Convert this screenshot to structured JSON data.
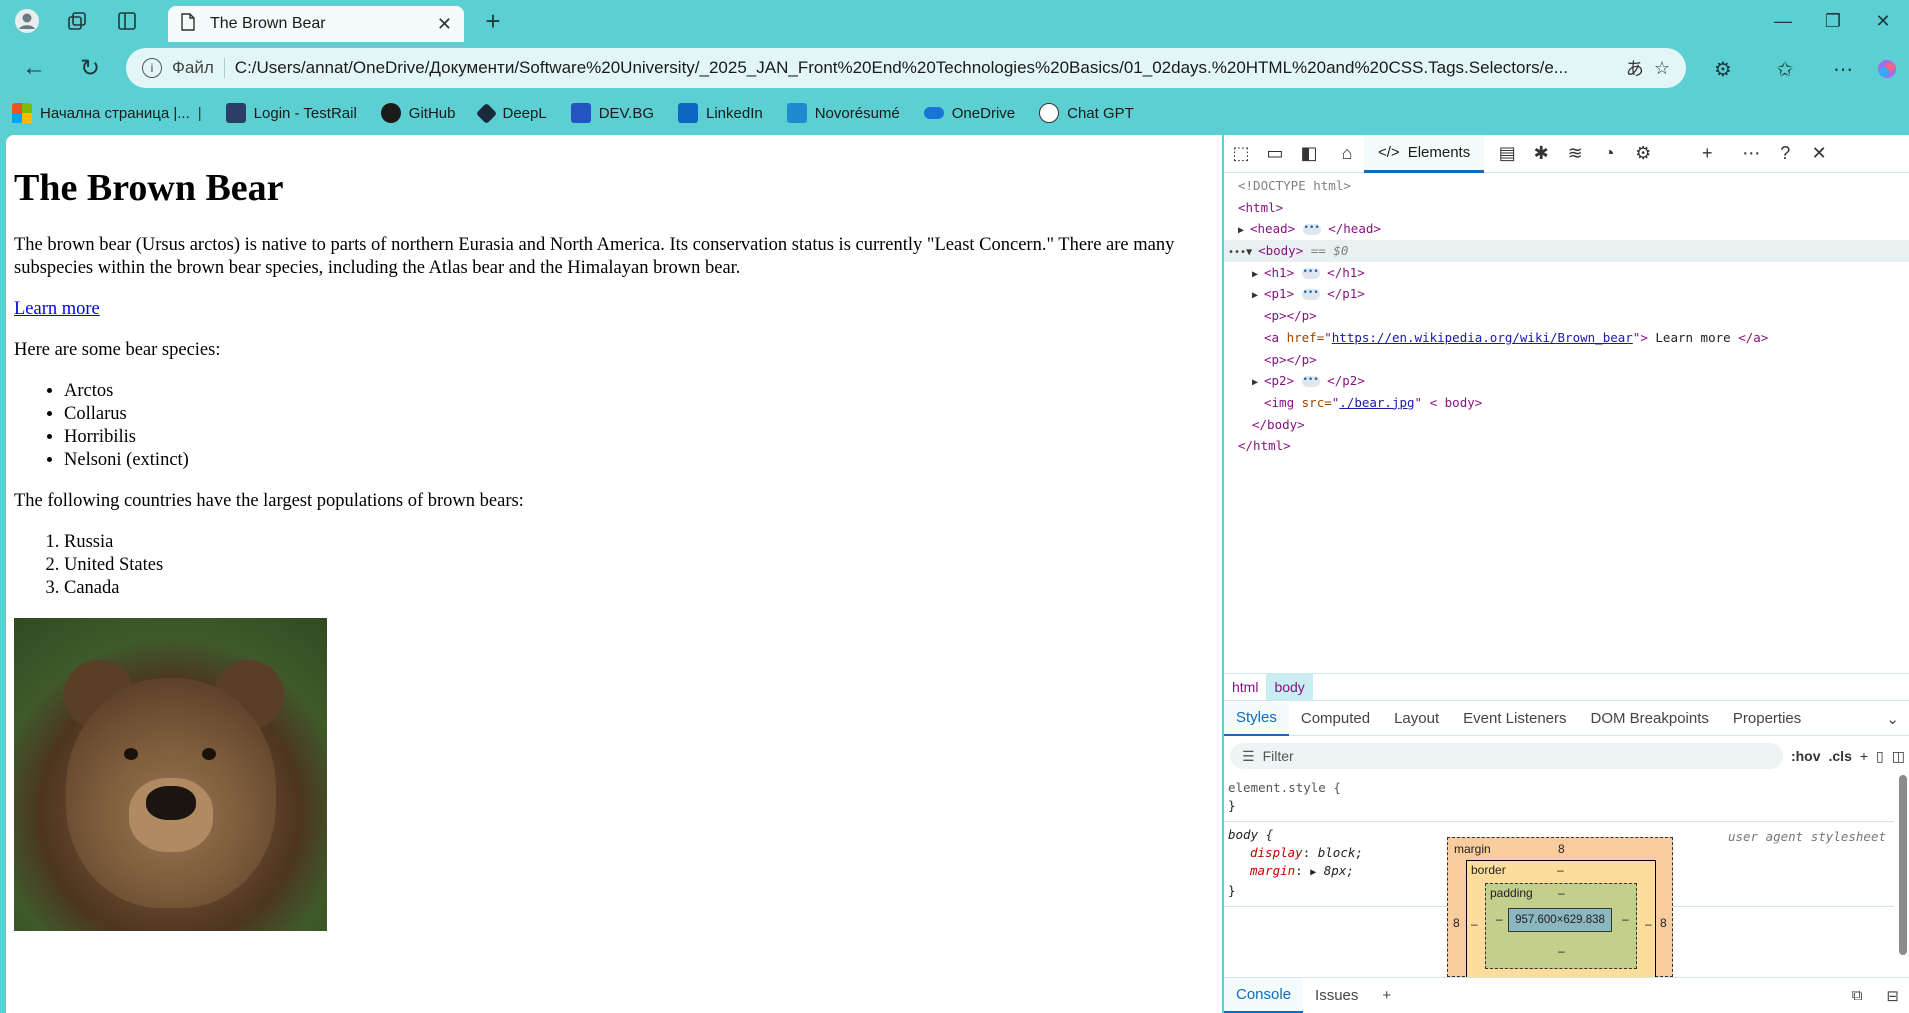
{
  "browser": {
    "tab_title": "The Brown Bear",
    "file_label": "Файл",
    "url": "C:/Users/annat/OneDrive/Документи/Software%20University/_2025_JAN_Front%20End%20Technologies%20Basics/01_02days.%20HTML%20and%20CSS.Tags.Selectors/e...",
    "translate_icon": "あ",
    "bookmarks": [
      {
        "label": "Начална страница |...",
        "icon": "microsoft-icon"
      },
      {
        "label": "Login - TestRail",
        "icon": "testrail-icon"
      },
      {
        "label": "GitHub",
        "icon": "github-icon"
      },
      {
        "label": "DeepL",
        "icon": "deepl-icon"
      },
      {
        "label": "DEV.BG",
        "icon": "devbg-icon"
      },
      {
        "label": "LinkedIn",
        "icon": "linkedin-icon"
      },
      {
        "label": "Novorésumé",
        "icon": "novoresume-icon"
      },
      {
        "label": "OneDrive",
        "icon": "onedrive-icon"
      },
      {
        "label": "Chat GPT",
        "icon": "chatgpt-icon"
      }
    ]
  },
  "page": {
    "heading": "The Brown Bear",
    "intro": "The brown bear (Ursus arctos) is native to parts of northern Eurasia and North America. Its conservation status is currently \"Least Concern.\" There are many subspecies within the brown bear species, including the Atlas bear and the Himalayan brown bear.",
    "link": "Learn more",
    "species_intro": "Here are some bear species:",
    "species": [
      "Arctos",
      "Collarus",
      "Horribilis",
      "Nelsoni (extinct)"
    ],
    "countries_intro": "The following countries have the largest populations of brown bears:",
    "countries": [
      "Russia",
      "United States",
      "Canada"
    ]
  },
  "devtools": {
    "elements_tab": "Elements",
    "dom": {
      "doctype": "<!DOCTYPE html>",
      "html_open": "<html>",
      "head": "<head>",
      "head_close": "</head>",
      "body": "<body>",
      "body_marker": "== $0",
      "h1": "<h1>",
      "h1_close": "</h1>",
      "p1": "<p1>",
      "p1_close": "</p1>",
      "p_empty": "<p></p>",
      "a_open": "<a",
      "a_href_attr": "href=",
      "a_href": "https://en.wikipedia.org/wiki/Brown_bear",
      "a_text": "Learn more",
      "a_close": "</a>",
      "p2": "<p2>",
      "p2_close": "</p2>",
      "img_open": "<img",
      "img_src_attr": "src=",
      "img_src": "./bear.jpg",
      "img_rest": "< body>",
      "body_close": "</body>",
      "html_close": "</html>"
    },
    "breadcrumbs": [
      "html",
      "body"
    ],
    "subtabs": [
      "Styles",
      "Computed",
      "Layout",
      "Event Listeners",
      "DOM Breakpoints",
      "Properties"
    ],
    "filter_placeholder": "Filter",
    "hov": ":hov",
    "cls": ".cls",
    "styles": {
      "element_style": "element.style {",
      "close_brace": "}",
      "body_selector": "body {",
      "ua": "user agent stylesheet",
      "prop1_name": "display",
      "prop1_value": "block;",
      "prop2_name": "margin",
      "prop2_value": "8px;"
    },
    "boxmodel": {
      "margin_label": "margin",
      "margin_value": "8",
      "border_label": "border",
      "padding_label": "padding",
      "dash": "–",
      "left": "8",
      "right": "8",
      "content": "957.600×629.838"
    },
    "drawer": [
      "Console",
      "Issues"
    ]
  }
}
